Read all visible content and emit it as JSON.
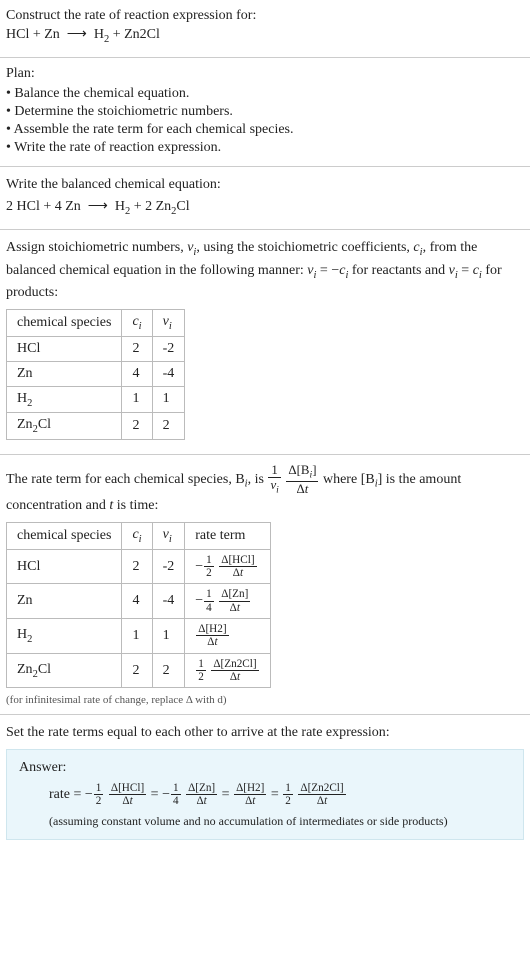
{
  "prompt": {
    "line1": "Construct the rate of reaction expression for:",
    "equation": "HCl + Zn ⟶ H₂ + Zn2Cl"
  },
  "plan": {
    "heading": "Plan:",
    "bullets": [
      "• Balance the chemical equation.",
      "• Determine the stoichiometric numbers.",
      "• Assemble the rate term for each chemical species.",
      "• Write the rate of reaction expression."
    ]
  },
  "balanced": {
    "text": "Write the balanced chemical equation:",
    "equation": "2 HCl + 4 Zn ⟶ H₂ + 2 Zn₂Cl"
  },
  "stoich": {
    "text_a": "Assign stoichiometric numbers, ",
    "text_b": ", using the stoichiometric coefficients, ",
    "text_c": ", from the balanced chemical equation in the following manner: ",
    "text_d": " for reactants and ",
    "text_e": " for products:",
    "headers": {
      "h1": "chemical species",
      "h2": "cᵢ",
      "h3": "νᵢ"
    },
    "rows": [
      {
        "sp": "HCl",
        "c": "2",
        "v": "-2"
      },
      {
        "sp": "Zn",
        "c": "4",
        "v": "-4"
      },
      {
        "sp": "H₂",
        "c": "1",
        "v": "1"
      },
      {
        "sp": "Zn₂Cl",
        "c": "2",
        "v": "2"
      }
    ]
  },
  "rateterm": {
    "text_a": "The rate term for each chemical species, ",
    "text_b": ", is ",
    "text_c": " where ",
    "text_d": " is the amount concentration and ",
    "text_e": " is time:",
    "headers": {
      "h1": "chemical species",
      "h2": "cᵢ",
      "h3": "νᵢ",
      "h4": "rate term"
    },
    "rows": [
      {
        "sp": "HCl",
        "c": "2",
        "v": "-2",
        "r_coef": "1",
        "r_coefden": "2",
        "r_sign": "-",
        "r_sp": "Δ[HCl]"
      },
      {
        "sp": "Zn",
        "c": "4",
        "v": "-4",
        "r_coef": "1",
        "r_coefden": "4",
        "r_sign": "-",
        "r_sp": "Δ[Zn]"
      },
      {
        "sp": "H₂",
        "c": "1",
        "v": "1",
        "r_coef": "",
        "r_coefden": "",
        "r_sign": "",
        "r_sp": "Δ[H2]"
      },
      {
        "sp": "Zn₂Cl",
        "c": "2",
        "v": "2",
        "r_coef": "1",
        "r_coefden": "2",
        "r_sign": "",
        "r_sp": "Δ[Zn2Cl]"
      }
    ],
    "footnote": "(for infinitesimal rate of change, replace Δ with d)"
  },
  "final": {
    "text": "Set the rate terms equal to each other to arrive at the rate expression:",
    "answer_label": "Answer:",
    "expr": {
      "lead": "rate = ",
      "t1": {
        "sign": "-",
        "num": "1",
        "den": "2",
        "dnum": "Δ[HCl]",
        "dden": "Δt"
      },
      "eq1": " = ",
      "t2": {
        "sign": "-",
        "num": "1",
        "den": "4",
        "dnum": "Δ[Zn]",
        "dden": "Δt"
      },
      "eq2": " = ",
      "t3": {
        "sign": "",
        "num": "",
        "den": "",
        "dnum": "Δ[H2]",
        "dden": "Δt"
      },
      "eq3": " = ",
      "t4": {
        "sign": "",
        "num": "1",
        "den": "2",
        "dnum": "Δ[Zn2Cl]",
        "dden": "Δt"
      }
    },
    "note": "(assuming constant volume and no accumulation of intermediates or side products)"
  },
  "chart_data": {
    "type": "table",
    "tables": [
      {
        "title": "Stoichiometric numbers",
        "columns": [
          "chemical species",
          "c_i",
          "ν_i"
        ],
        "rows": [
          [
            "HCl",
            2,
            -2
          ],
          [
            "Zn",
            4,
            -4
          ],
          [
            "H2",
            1,
            1
          ],
          [
            "Zn2Cl",
            2,
            2
          ]
        ]
      },
      {
        "title": "Rate terms",
        "columns": [
          "chemical species",
          "c_i",
          "ν_i",
          "rate term"
        ],
        "rows": [
          [
            "HCl",
            2,
            -2,
            "-(1/2) Δ[HCl]/Δt"
          ],
          [
            "Zn",
            4,
            -4,
            "-(1/4) Δ[Zn]/Δt"
          ],
          [
            "H2",
            1,
            1,
            "Δ[H2]/Δt"
          ],
          [
            "Zn2Cl",
            2,
            2,
            "(1/2) Δ[Zn2Cl]/Δt"
          ]
        ]
      }
    ]
  }
}
